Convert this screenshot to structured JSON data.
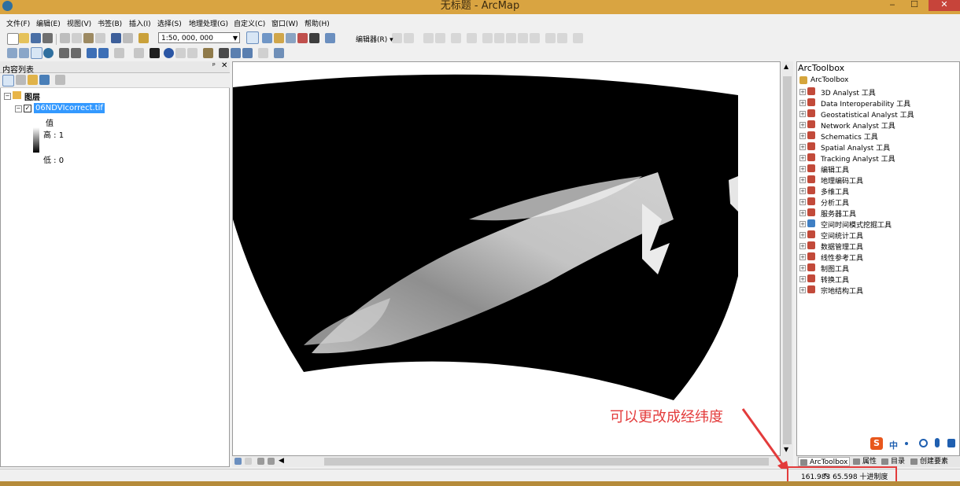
{
  "window": {
    "title": "无标题 - ArcMap"
  },
  "menu": [
    "文件(F)",
    "编辑(E)",
    "视图(V)",
    "书签(B)",
    "插入(I)",
    "选择(S)",
    "地理处理(G)",
    "自定义(C)",
    "窗口(W)",
    "帮助(H)"
  ],
  "toolbar": {
    "scale": "1:50, 000, 000",
    "editor_label": "编辑器(R) ▾"
  },
  "toc": {
    "title": "内容列表",
    "group_label": "图层",
    "layer_name": "06NDVIcorrect.tif",
    "legend_value_label": "值",
    "high_label": "高 : 1",
    "low_label": "低 : 0"
  },
  "annotation": "可以更改成经纬度",
  "toolbox": {
    "title": "ArcToolbox",
    "root": "ArcToolbox",
    "items": [
      "3D Analyst 工具",
      "Data Interoperability 工具",
      "Geostatistical Analyst 工具",
      "Network Analyst 工具",
      "Schematics 工具",
      "Spatial Analyst 工具",
      "Tracking Analyst 工具",
      "编辑工具",
      "地理编码工具",
      "多维工具",
      "分析工具",
      "服务器工具",
      "空间时间模式挖掘工具",
      "空间统计工具",
      "数据管理工具",
      "线性参考工具",
      "制图工具",
      "转换工具",
      "宗地结构工具"
    ]
  },
  "tabs": [
    "ArcToolbox",
    "属性",
    "目录",
    "创建要素"
  ],
  "ime": {
    "lang": "中"
  },
  "status": {
    "coordinates": "161.983 65.598 十进制度"
  },
  "colors": {
    "title_bar": "#d9a441",
    "annotation": "#e33b3b",
    "selection": "#3399ff"
  }
}
